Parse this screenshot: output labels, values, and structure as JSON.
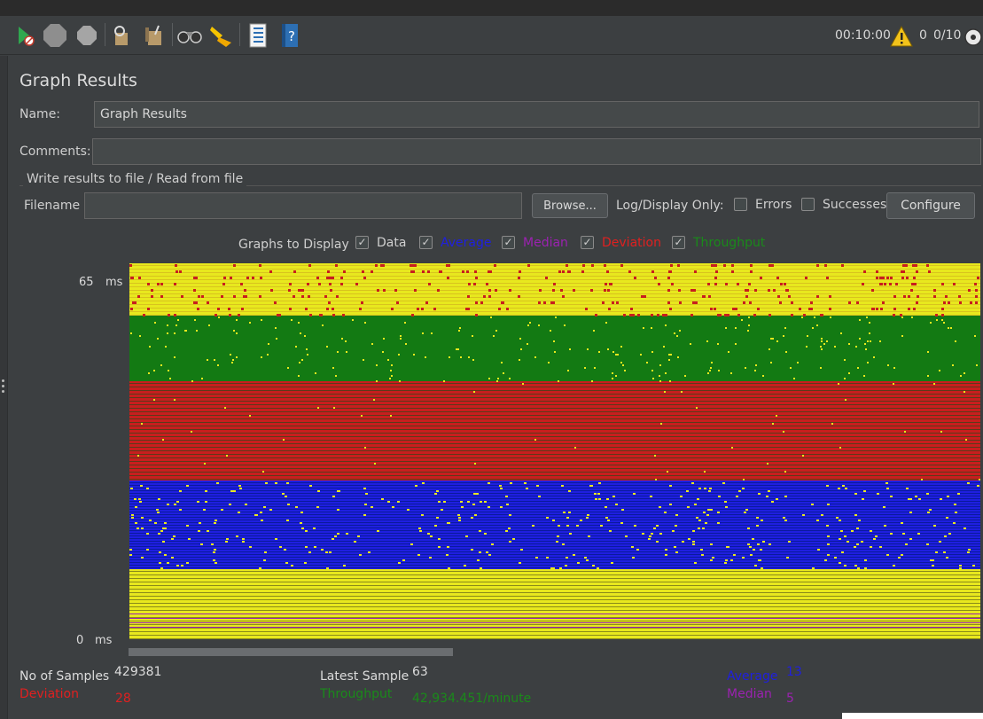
{
  "toolbar": {
    "elapsed_time": "00:10:00",
    "warning_count": "0",
    "threads": "0/10"
  },
  "page": {
    "title": "Graph Results"
  },
  "form": {
    "name_label": "Name:",
    "name_value": "Graph Results",
    "comments_label": "Comments:",
    "comments_value": "",
    "file_group_title": "Write results to file / Read from file",
    "filename_label": "Filename",
    "filename_value": "",
    "browse_label": "Browse...",
    "log_display_label": "Log/Display Only:",
    "errors_label": "Errors",
    "successes_label": "Successes",
    "configure_label": "Configure"
  },
  "graphs_to_display": {
    "label": "Graphs to Display",
    "options": [
      {
        "label": "Data",
        "checked": true,
        "color": "#1a1a1a"
      },
      {
        "label": "Average",
        "checked": true,
        "color": "#1f1fe0"
      },
      {
        "label": "Median",
        "checked": true,
        "color": "#9b22b0"
      },
      {
        "label": "Deviation",
        "checked": true,
        "color": "#e02020"
      },
      {
        "label": "Throughput",
        "checked": true,
        "color": "#1a8a1a"
      }
    ]
  },
  "axis": {
    "y_max_value": "65",
    "y_max_unit": "ms",
    "y_min_value": "0",
    "y_min_unit": "ms"
  },
  "colors": {
    "data": "#e8e81e",
    "average": "#1f1fe0",
    "median": "#9b22b0",
    "deviation": "#c81e1e",
    "throughput": "#137a13"
  },
  "chart_data": {
    "type": "line",
    "ylim": [
      0,
      65
    ],
    "ylabel_unit": "ms",
    "grid": false,
    "series": [
      {
        "name": "Average",
        "value": 13
      },
      {
        "name": "Median",
        "value": 5
      },
      {
        "name": "Deviation",
        "value": 28
      },
      {
        "name": "Throughput",
        "value_text": "42,934.451/minute"
      }
    ]
  },
  "stats": {
    "samples_label": "No of Samples",
    "samples_value": "429381",
    "latest_label": "Latest Sample",
    "latest_value": "63",
    "average_label": "Average",
    "average_value": "13",
    "deviation_label": "Deviation",
    "deviation_value": "28",
    "throughput_label": "Throughput",
    "throughput_value": "42,934.451/minute",
    "median_label": "Median",
    "median_value": "5"
  }
}
